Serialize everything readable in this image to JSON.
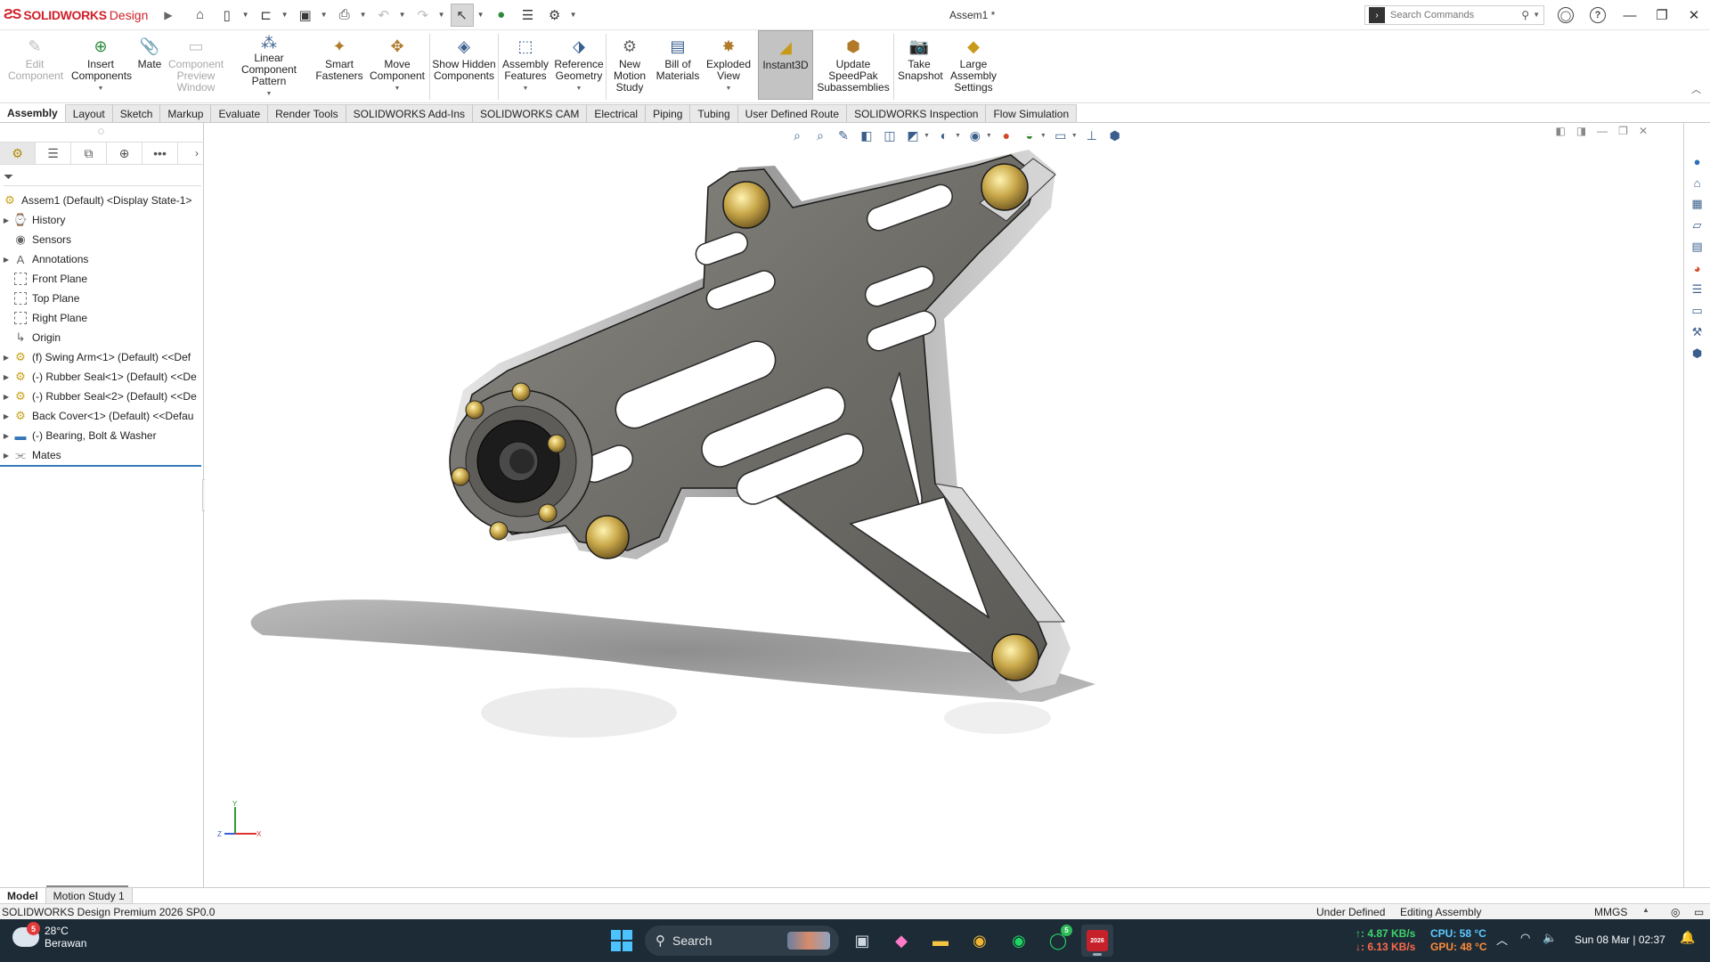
{
  "app": {
    "logo_bold": "SOLIDWORKS",
    "logo_light": "Design",
    "doc_title": "Assem1 *",
    "search_placeholder": "Search Commands"
  },
  "ribbon": {
    "items": [
      {
        "label": "Edit Component",
        "icon": "edit-component-icon",
        "disabled": true
      },
      {
        "label": "Insert Components",
        "icon": "insert-components-icon",
        "dropdown": true
      },
      {
        "label": "Mate",
        "icon": "mate-icon"
      },
      {
        "label": "Component Preview Window",
        "icon": "preview-window-icon",
        "disabled": true
      },
      {
        "label": "Linear Component Pattern",
        "icon": "linear-pattern-icon",
        "dropdown": true
      },
      {
        "label": "Smart Fasteners",
        "icon": "smart-fasteners-icon"
      },
      {
        "label": "Move Component",
        "icon": "move-component-icon",
        "dropdown": true
      },
      {
        "label": "Show Hidden Components",
        "icon": "show-hidden-icon"
      },
      {
        "label": "Assembly Features",
        "icon": "assembly-features-icon",
        "dropdown": true
      },
      {
        "label": "Reference Geometry",
        "icon": "reference-geometry-icon",
        "dropdown": true
      },
      {
        "label": "New Motion Study",
        "icon": "motion-study-icon"
      },
      {
        "label": "Bill of Materials",
        "icon": "bom-icon"
      },
      {
        "label": "Exploded View",
        "icon": "exploded-view-icon",
        "dropdown": true
      },
      {
        "label": "Instant3D",
        "icon": "instant3d-icon",
        "active": true
      },
      {
        "label": "Update SpeedPak Subassemblies",
        "icon": "speedpak-icon"
      },
      {
        "label": "Take Snapshot",
        "icon": "camera-icon"
      },
      {
        "label": "Large Assembly Settings",
        "icon": "large-assembly-icon"
      }
    ]
  },
  "tabs": [
    "Assembly",
    "Layout",
    "Sketch",
    "Markup",
    "Evaluate",
    "Render Tools",
    "SOLIDWORKS Add-Ins",
    "SOLIDWORKS CAM",
    "Electrical",
    "Piping",
    "Tubing",
    "User Defined Route",
    "SOLIDWORKS Inspection",
    "Flow Simulation"
  ],
  "active_tab": "Assembly",
  "tree": {
    "root": "Assem1 (Default) <Display State-1>",
    "items": [
      {
        "label": "History",
        "icon": "history-icon",
        "expand": true
      },
      {
        "label": "Sensors",
        "icon": "sensors-icon",
        "expand": false
      },
      {
        "label": "Annotations",
        "icon": "annotations-icon",
        "expand": true
      },
      {
        "label": "Front Plane",
        "icon": "plane-icon",
        "expand": false
      },
      {
        "label": "Top Plane",
        "icon": "plane-icon",
        "expand": false
      },
      {
        "label": "Right Plane",
        "icon": "plane-icon",
        "expand": false
      },
      {
        "label": "Origin",
        "icon": "origin-icon",
        "expand": false
      },
      {
        "label": "(f) Swing Arm<1> (Default) <<Def",
        "icon": "part-icon",
        "expand": true
      },
      {
        "label": "(-) Rubber Seal<1> (Default) <<De",
        "icon": "part-icon",
        "expand": true
      },
      {
        "label": "(-) Rubber Seal<2> (Default) <<De",
        "icon": "part-icon",
        "expand": true
      },
      {
        "label": "Back Cover<1> (Default) <<Defau",
        "icon": "part-icon",
        "expand": true
      },
      {
        "label": "(-) Bearing, Bolt & Washer",
        "icon": "folder-icon",
        "expand": true
      },
      {
        "label": "Mates",
        "icon": "mates-icon",
        "expand": true
      }
    ]
  },
  "bottom_tabs": [
    "Model",
    "Motion Study 1"
  ],
  "status": {
    "product": "SOLIDWORKS Design Premium 2026 SP0.0",
    "defined": "Under Defined",
    "mode": "Editing Assembly",
    "units": "MMGS"
  },
  "taskbar": {
    "weather_temp": "28°C",
    "weather_desc": "Berawan",
    "weather_badge": "5",
    "search_label": "Search",
    "whatsapp_badge": "5",
    "net_up": "↑: 4.87 KB/s",
    "net_down": "↓: 6.13 KB/s",
    "cpu": "CPU: 58 °C",
    "gpu": "GPU: 48 °C",
    "clock": "Sun 08 Mar | 02:37",
    "sw_label": "2026"
  },
  "triad": {
    "y": "Y",
    "x": "X",
    "z": "Z"
  },
  "colors": {
    "brand": "#d0202a",
    "accent": "#3577b8",
    "taskbar": "#1c2b36"
  }
}
